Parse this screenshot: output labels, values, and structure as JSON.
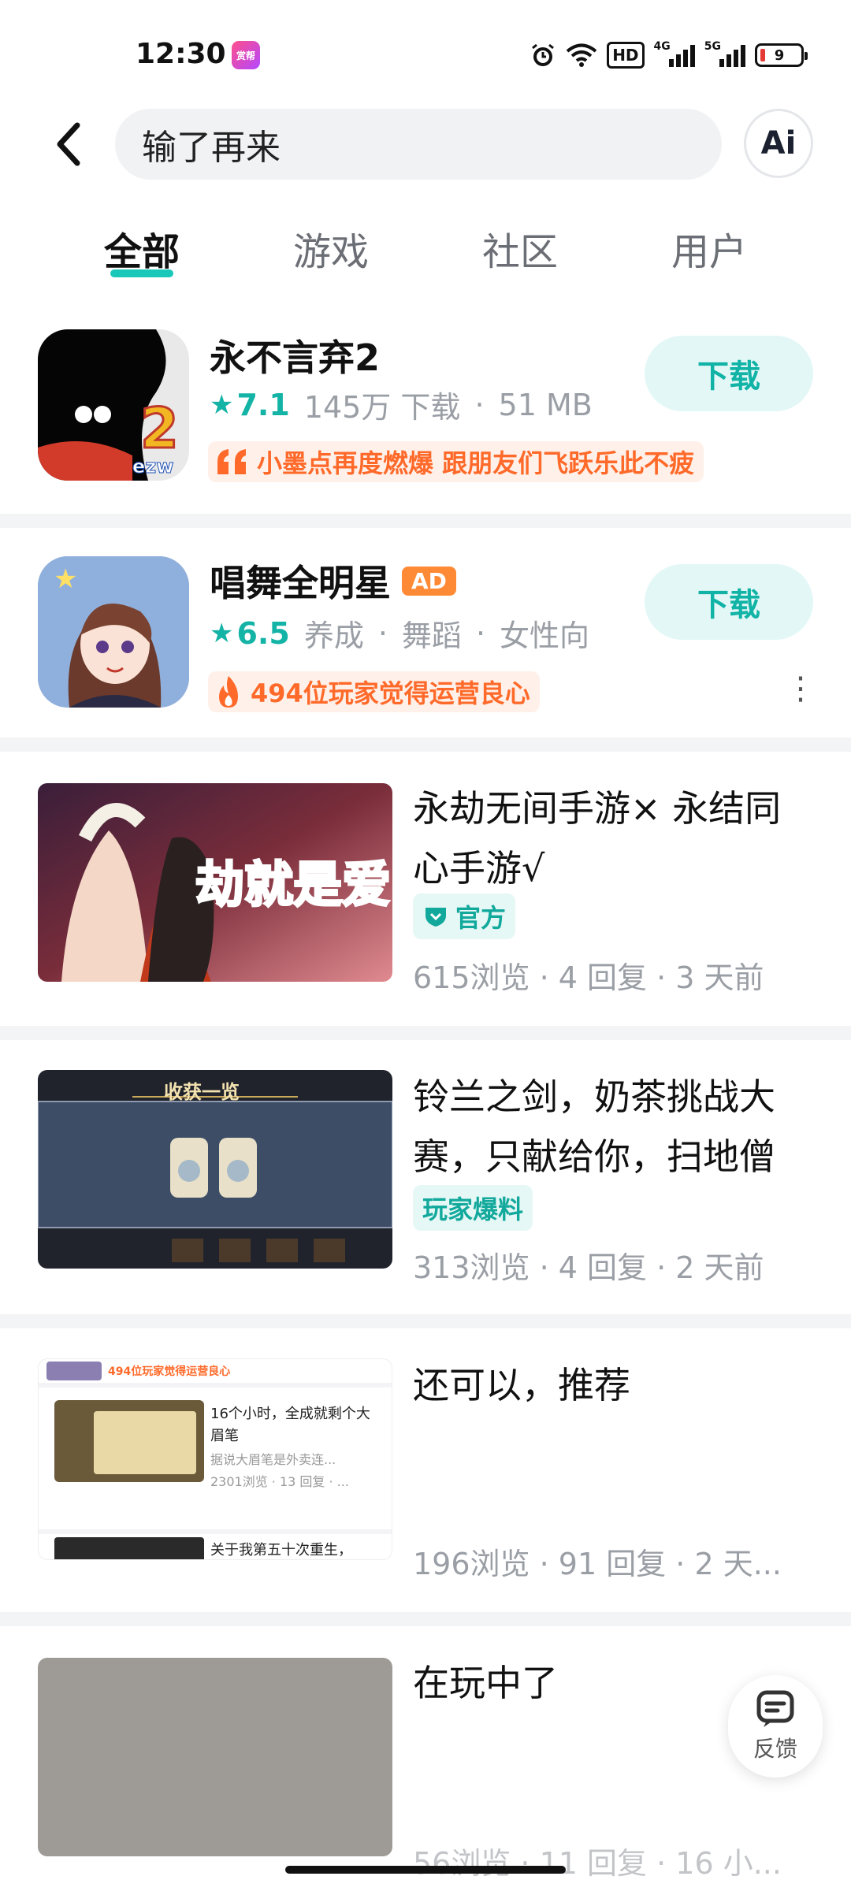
{
  "status_bar": {
    "time": "12:30",
    "notification_app": "赏帮",
    "hd_label": "HD",
    "net_4g": "4G",
    "net_5g": "5G",
    "battery": "9"
  },
  "search": {
    "query": "输了再来",
    "ai_label": "Ai"
  },
  "tabs": [
    {
      "label": "全部",
      "active": true
    },
    {
      "label": "游戏",
      "active": false
    },
    {
      "label": "社区",
      "active": false
    },
    {
      "label": "用户",
      "active": false
    }
  ],
  "apps": [
    {
      "title": "永不言弃2",
      "score": "7.1",
      "meta": [
        "145万 下载",
        "51 MB"
      ],
      "tag": "小墨点再度燃爆 跟朋友们飞跃乐此不疲",
      "tag_icon": "quote-icon",
      "download_label": "下载",
      "icon_text": "ezw"
    },
    {
      "title": "唱舞全明星",
      "ad_label": "AD",
      "score": "6.5",
      "meta": [
        "养成",
        "舞蹈",
        "女性向"
      ],
      "tag": "494位玩家觉得运营良心",
      "tag_icon": "flame-icon",
      "download_label": "下载"
    }
  ],
  "posts": [
    {
      "title": "永劫无间手游× 永结同心手游√",
      "badge": "官方",
      "stats": "615浏览 · 4 回复 · 3 天前",
      "thumb_text": "劫就是爱"
    },
    {
      "title": "铃兰之剑，奶茶挑战大赛，只献给你，扫地僧",
      "badge": "玩家爆料",
      "stats": "313浏览 · 4 回复 · 2 天前",
      "thumb_text": "收获一览"
    },
    {
      "title": "还可以，推荐",
      "stats": "196浏览 · 91 回复 · 2 天...",
      "thumb_banner": "494位玩家觉得运营良心",
      "thumb_item1_title": "16个小时，全成就剩个大眉笔",
      "thumb_item1_desc": "据说大眉笔是外卖连...",
      "thumb_item1_stats": "2301浏览 · 13 回复 · ...",
      "thumb_item2_title": "关于我第五十次重生，"
    },
    {
      "title": "在玩中了",
      "stats": "56浏览 · 11 回复 · 16 小..."
    }
  ],
  "feedback_label": "反馈",
  "colors": {
    "accent": "#19c8b9",
    "orange": "#ff6a2a",
    "ad": "#ff8a35"
  }
}
